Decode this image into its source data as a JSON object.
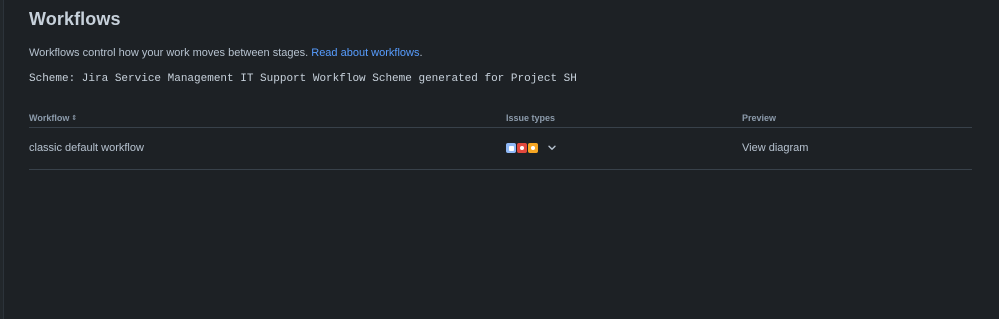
{
  "page": {
    "title": "Workflows",
    "description_prefix": "Workflows control how your work moves between stages. ",
    "description_link": "Read about workflows",
    "description_suffix": ".",
    "scheme_text": "Scheme: Jira Service Management IT Support Workflow Scheme generated for Project SH"
  },
  "table": {
    "columns": [
      "Workflow",
      "Issue types",
      "Preview"
    ],
    "rows": [
      {
        "workflow": "classic default workflow",
        "issue_types": [
          "task-icon",
          "bug-icon",
          "story-icon"
        ],
        "preview_link": "View diagram"
      }
    ]
  },
  "colors": {
    "background": "#1d2125",
    "link": "#579dff",
    "divider": "#38414a"
  }
}
